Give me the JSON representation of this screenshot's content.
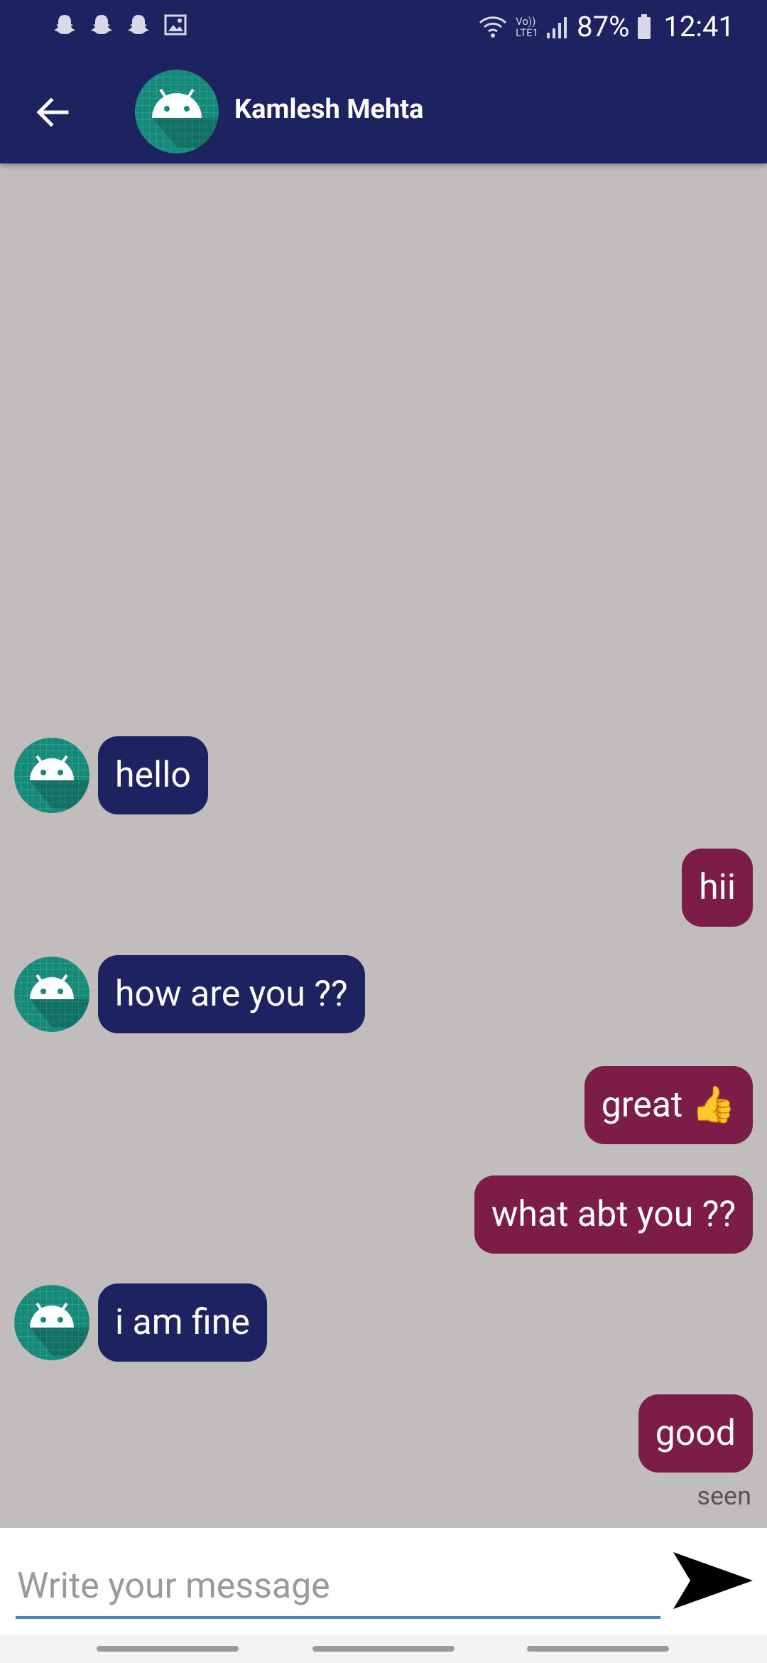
{
  "status": {
    "battery": "87%",
    "time": "12:41",
    "volte": "Vo))",
    "lte": "LTE1"
  },
  "header": {
    "contact_name": "Kamlesh Mehta"
  },
  "messages": [
    {
      "side": "incoming",
      "text": "hello"
    },
    {
      "side": "outgoing",
      "text": "hii"
    },
    {
      "side": "incoming",
      "text": "how are you ??"
    },
    {
      "side": "outgoing",
      "text": "great 👍"
    },
    {
      "side": "outgoing",
      "text": "what abt you ??"
    },
    {
      "side": "incoming",
      "text": "i am fine"
    },
    {
      "side": "outgoing",
      "text": "good"
    }
  ],
  "seen_label": "seen",
  "composer": {
    "placeholder": "Write your message",
    "value": ""
  },
  "colors": {
    "header": "#1d2260",
    "incoming_bubble": "#1d2260",
    "outgoing_bubble": "#7b1d47",
    "background": "#c1bdbd",
    "avatar": "#15897a"
  }
}
